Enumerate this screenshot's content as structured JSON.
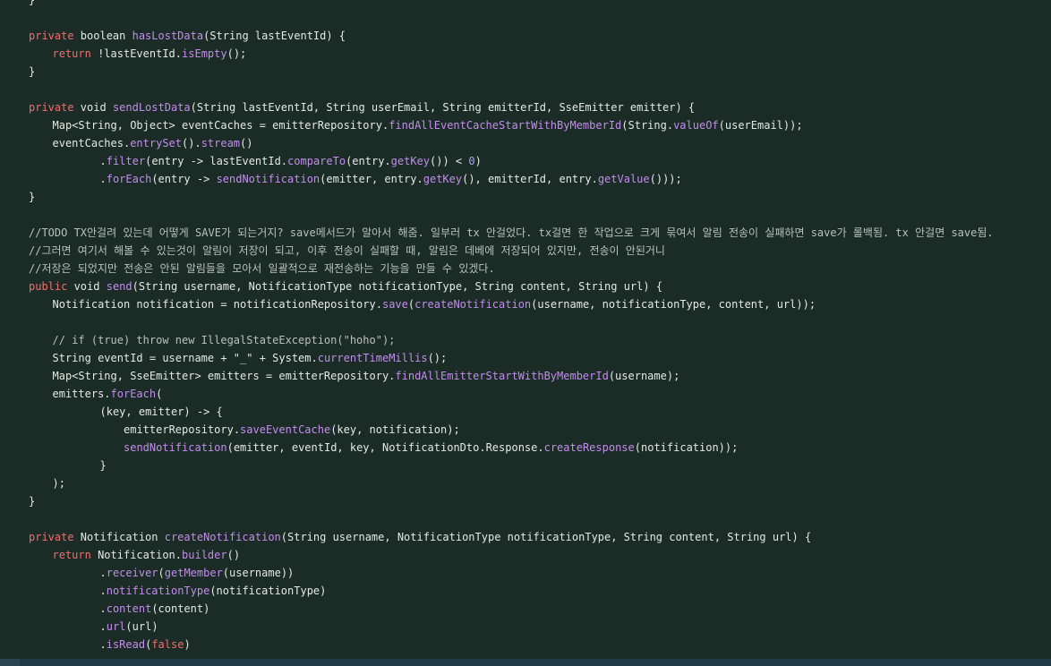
{
  "editor": {
    "language": "java",
    "colors": {
      "background": "#1b2b26",
      "keyword": "#ef6e6e",
      "function": "#c38ded",
      "text": "#e4e9e6",
      "number": "#a9a6f2",
      "comment": "#b9c1bd",
      "statusbar": "#1f3a44"
    },
    "lines": [
      {
        "indent": 0,
        "tokens": [
          [
            "plain",
            "}"
          ]
        ]
      },
      {
        "indent": 0,
        "tokens": []
      },
      {
        "indent": 0,
        "tokens": [
          [
            "kw",
            "private"
          ],
          [
            "plain",
            " boolean "
          ],
          [
            "fn",
            "hasLostData"
          ],
          [
            "plain",
            "(String lastEventId) {"
          ]
        ]
      },
      {
        "indent": 1,
        "tokens": [
          [
            "kw",
            "return"
          ],
          [
            "plain",
            " !lastEventId."
          ],
          [
            "fn",
            "isEmpty"
          ],
          [
            "plain",
            "();"
          ]
        ]
      },
      {
        "indent": 0,
        "tokens": [
          [
            "plain",
            "}"
          ]
        ]
      },
      {
        "indent": 0,
        "tokens": []
      },
      {
        "indent": 0,
        "tokens": [
          [
            "kw",
            "private"
          ],
          [
            "plain",
            " void "
          ],
          [
            "fn",
            "sendLostData"
          ],
          [
            "plain",
            "(String lastEventId, String userEmail, String emitterId, SseEmitter emitter) {"
          ]
        ]
      },
      {
        "indent": 1,
        "tokens": [
          [
            "plain",
            "Map<String, Object> eventCaches = emitterRepository."
          ],
          [
            "fn",
            "findAllEventCacheStartWithByMemberId"
          ],
          [
            "plain",
            "(String."
          ],
          [
            "fn",
            "valueOf"
          ],
          [
            "plain",
            "(userEmail));"
          ]
        ]
      },
      {
        "indent": 1,
        "tokens": [
          [
            "plain",
            "eventCaches."
          ],
          [
            "fn",
            "entrySet"
          ],
          [
            "plain",
            "()."
          ],
          [
            "fn",
            "stream"
          ],
          [
            "plain",
            "()"
          ]
        ]
      },
      {
        "indent": 3,
        "tokens": [
          [
            "plain",
            "."
          ],
          [
            "fn",
            "filter"
          ],
          [
            "plain",
            "(entry -> lastEventId."
          ],
          [
            "fn",
            "compareTo"
          ],
          [
            "plain",
            "(entry."
          ],
          [
            "fn",
            "getKey"
          ],
          [
            "plain",
            "()) < "
          ],
          [
            "num",
            "0"
          ],
          [
            "plain",
            ")"
          ]
        ]
      },
      {
        "indent": 3,
        "tokens": [
          [
            "plain",
            "."
          ],
          [
            "fn",
            "forEach"
          ],
          [
            "plain",
            "(entry -> "
          ],
          [
            "fn",
            "sendNotification"
          ],
          [
            "plain",
            "(emitter, entry."
          ],
          [
            "fn",
            "getKey"
          ],
          [
            "plain",
            "(), emitterId, entry."
          ],
          [
            "fn",
            "getValue"
          ],
          [
            "plain",
            "()));"
          ]
        ]
      },
      {
        "indent": 0,
        "tokens": [
          [
            "plain",
            "}"
          ]
        ]
      },
      {
        "indent": 0,
        "tokens": []
      },
      {
        "indent": 0,
        "tokens": [
          [
            "comment",
            "//TODO TX안걸려 있는데 어떻게 SAVE가 되는거지? save메서드가 알아서 해줌. 일부러 tx 안걸었다. tx걸면 한 작업으로 크게 묶여서 알림 전송이 실패하면 save가 롤백됨. tx 안걸면 save됨."
          ]
        ]
      },
      {
        "indent": 0,
        "tokens": [
          [
            "comment",
            "//그러면 여기서 해볼 수 있는것이 알림이 저장이 되고, 이후 전송이 실패할 때, 알림은 데베에 저장되어 있지만, 전송이 안된거니"
          ]
        ]
      },
      {
        "indent": 0,
        "tokens": [
          [
            "comment",
            "//저장은 되었지만 전송은 안된 알림들을 모아서 일괄적으로 재전송하는 기능을 만들 수 있겠다."
          ]
        ]
      },
      {
        "indent": 0,
        "tokens": [
          [
            "kw",
            "public"
          ],
          [
            "plain",
            " void "
          ],
          [
            "fn",
            "send"
          ],
          [
            "plain",
            "(String username, NotificationType notificationType, String content, String url) {"
          ]
        ]
      },
      {
        "indent": 1,
        "tokens": [
          [
            "plain",
            "Notification notification = notificationRepository."
          ],
          [
            "fn",
            "save"
          ],
          [
            "plain",
            "("
          ],
          [
            "fn",
            "createNotification"
          ],
          [
            "plain",
            "(username, notificationType, content, url));"
          ]
        ]
      },
      {
        "indent": 0,
        "tokens": []
      },
      {
        "indent": 1,
        "tokens": [
          [
            "comment",
            "// if (true) throw new IllegalStateException(\"hoho\");"
          ]
        ]
      },
      {
        "indent": 1,
        "tokens": [
          [
            "plain",
            "String eventId = username + "
          ],
          [
            "str",
            "\"_\""
          ],
          [
            "plain",
            " + System."
          ],
          [
            "fn",
            "currentTimeMillis"
          ],
          [
            "plain",
            "();"
          ]
        ]
      },
      {
        "indent": 1,
        "tokens": [
          [
            "plain",
            "Map<String, SseEmitter> emitters = emitterRepository."
          ],
          [
            "fn",
            "findAllEmitterStartWithByMemberId"
          ],
          [
            "plain",
            "(username);"
          ]
        ]
      },
      {
        "indent": 1,
        "tokens": [
          [
            "plain",
            "emitters."
          ],
          [
            "fn",
            "forEach"
          ],
          [
            "plain",
            "("
          ]
        ]
      },
      {
        "indent": 3,
        "tokens": [
          [
            "plain",
            "(key, emitter) -> {"
          ]
        ]
      },
      {
        "indent": 4,
        "tokens": [
          [
            "plain",
            "emitterRepository."
          ],
          [
            "fn",
            "saveEventCache"
          ],
          [
            "plain",
            "(key, notification);"
          ]
        ]
      },
      {
        "indent": 4,
        "tokens": [
          [
            "fn",
            "sendNotification"
          ],
          [
            "plain",
            "(emitter, eventId, key, NotificationDto.Response."
          ],
          [
            "fn",
            "createResponse"
          ],
          [
            "plain",
            "(notification));"
          ]
        ]
      },
      {
        "indent": 3,
        "tokens": [
          [
            "plain",
            "}"
          ]
        ]
      },
      {
        "indent": 1,
        "tokens": [
          [
            "plain",
            ");"
          ]
        ]
      },
      {
        "indent": 0,
        "tokens": [
          [
            "plain",
            "}"
          ]
        ]
      },
      {
        "indent": 0,
        "tokens": []
      },
      {
        "indent": 0,
        "tokens": [
          [
            "kw",
            "private"
          ],
          [
            "plain",
            " Notification "
          ],
          [
            "fn",
            "createNotification"
          ],
          [
            "plain",
            "(String username, NotificationType notificationType, String content, String url) {"
          ]
        ]
      },
      {
        "indent": 1,
        "tokens": [
          [
            "kw",
            "return"
          ],
          [
            "plain",
            " Notification."
          ],
          [
            "fn",
            "builder"
          ],
          [
            "plain",
            "()"
          ]
        ]
      },
      {
        "indent": 3,
        "tokens": [
          [
            "plain",
            "."
          ],
          [
            "fn",
            "receiver"
          ],
          [
            "plain",
            "("
          ],
          [
            "fn",
            "getMember"
          ],
          [
            "plain",
            "(username))"
          ]
        ]
      },
      {
        "indent": 3,
        "tokens": [
          [
            "plain",
            "."
          ],
          [
            "fn",
            "notificationType"
          ],
          [
            "plain",
            "(notificationType)"
          ]
        ]
      },
      {
        "indent": 3,
        "tokens": [
          [
            "plain",
            "."
          ],
          [
            "fn",
            "content"
          ],
          [
            "plain",
            "(content)"
          ]
        ]
      },
      {
        "indent": 3,
        "tokens": [
          [
            "plain",
            "."
          ],
          [
            "fn",
            "url"
          ],
          [
            "plain",
            "(url)"
          ]
        ]
      },
      {
        "indent": 3,
        "tokens": [
          [
            "plain",
            "."
          ],
          [
            "fn",
            "isRead"
          ],
          [
            "plain",
            "("
          ],
          [
            "kw",
            "false"
          ],
          [
            "plain",
            ")"
          ]
        ]
      }
    ]
  }
}
